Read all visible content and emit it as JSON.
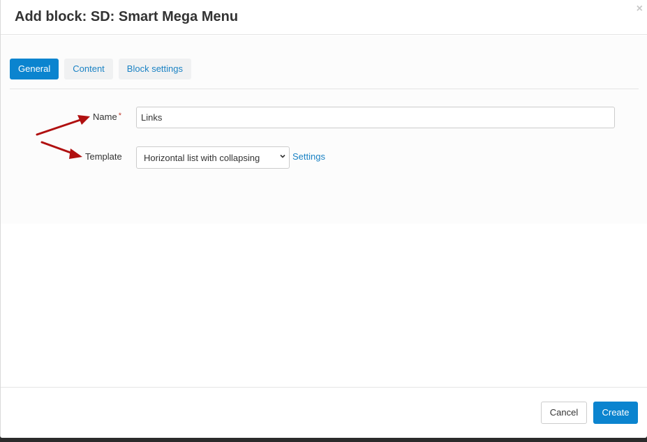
{
  "dialog": {
    "title": "Add block: SD: Smart Mega Menu",
    "close_symbol": "×"
  },
  "tabs": [
    {
      "label": "General",
      "active": true
    },
    {
      "label": "Content",
      "active": false
    },
    {
      "label": "Block settings",
      "active": false
    }
  ],
  "form": {
    "name_label": "Name",
    "required_mark": "*",
    "name_value": "Links",
    "template_label": "Template",
    "template_selected": "Horizontal list with collapsing",
    "settings_link": "Settings"
  },
  "footer": {
    "cancel_label": "Cancel",
    "create_label": "Create"
  },
  "colors": {
    "primary": "#0b84cf",
    "link": "#1a82c4",
    "annotation_arrow": "#b01010",
    "required": "#c0392b"
  },
  "icons": {
    "close": "close-icon",
    "dropdown": "chevron-down-icon",
    "annotation": "arrow-annotation-icon"
  }
}
